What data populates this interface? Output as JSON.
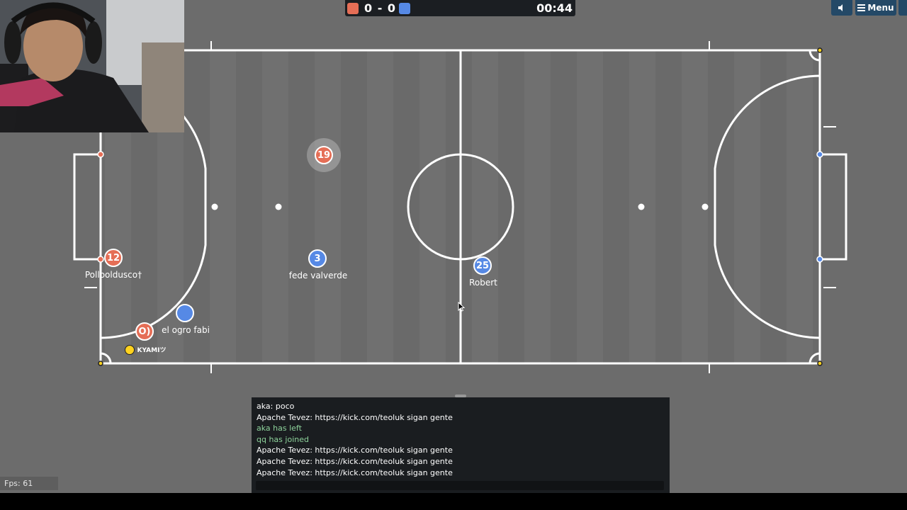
{
  "scoreboard": {
    "red_color": "#e56e56",
    "blue_color": "#5689e5",
    "score": "0 - 0",
    "timer": "00:44"
  },
  "top_controls": {
    "sound_icon": "speaker-icon",
    "menu_icon": "hamburger-icon",
    "menu_label": "Menu"
  },
  "players": [
    {
      "number": "19",
      "team": "red",
      "name": ""
    },
    {
      "number": "3",
      "team": "blue",
      "name": "fede valverde"
    },
    {
      "number": "25",
      "team": "blue",
      "name": "Robert"
    },
    {
      "number": "12",
      "team": "red",
      "name": "Pollooldusco†"
    },
    {
      "number": "",
      "team": "blue",
      "name": "el ogro fabi"
    },
    {
      "number": "O)",
      "team": "red",
      "name": "KYAMIツ"
    }
  ],
  "chat": {
    "messages": [
      {
        "text": "aka: poco",
        "type": "message"
      },
      {
        "text": "Apache Tevez: https://kick.com/teoluk sigan gente",
        "type": "message"
      },
      {
        "text": "aka has left",
        "type": "notice"
      },
      {
        "text": "qq has joined",
        "type": "notice"
      },
      {
        "text": "Apache Tevez: https://kick.com/teoluk sigan gente",
        "type": "message"
      },
      {
        "text": "Apache Tevez: https://kick.com/teoluk sigan gente",
        "type": "message"
      },
      {
        "text": "Apache Tevez: https://kick.com/teoluk sigan gente",
        "type": "message"
      }
    ],
    "input_value": ""
  },
  "fps": "Fps: 61",
  "colors": {
    "pitch": "#6c6c6c",
    "line": "#ffffff",
    "red_team": "#e56e56",
    "blue_team": "#5689e5",
    "ball": "#ffd21f"
  }
}
